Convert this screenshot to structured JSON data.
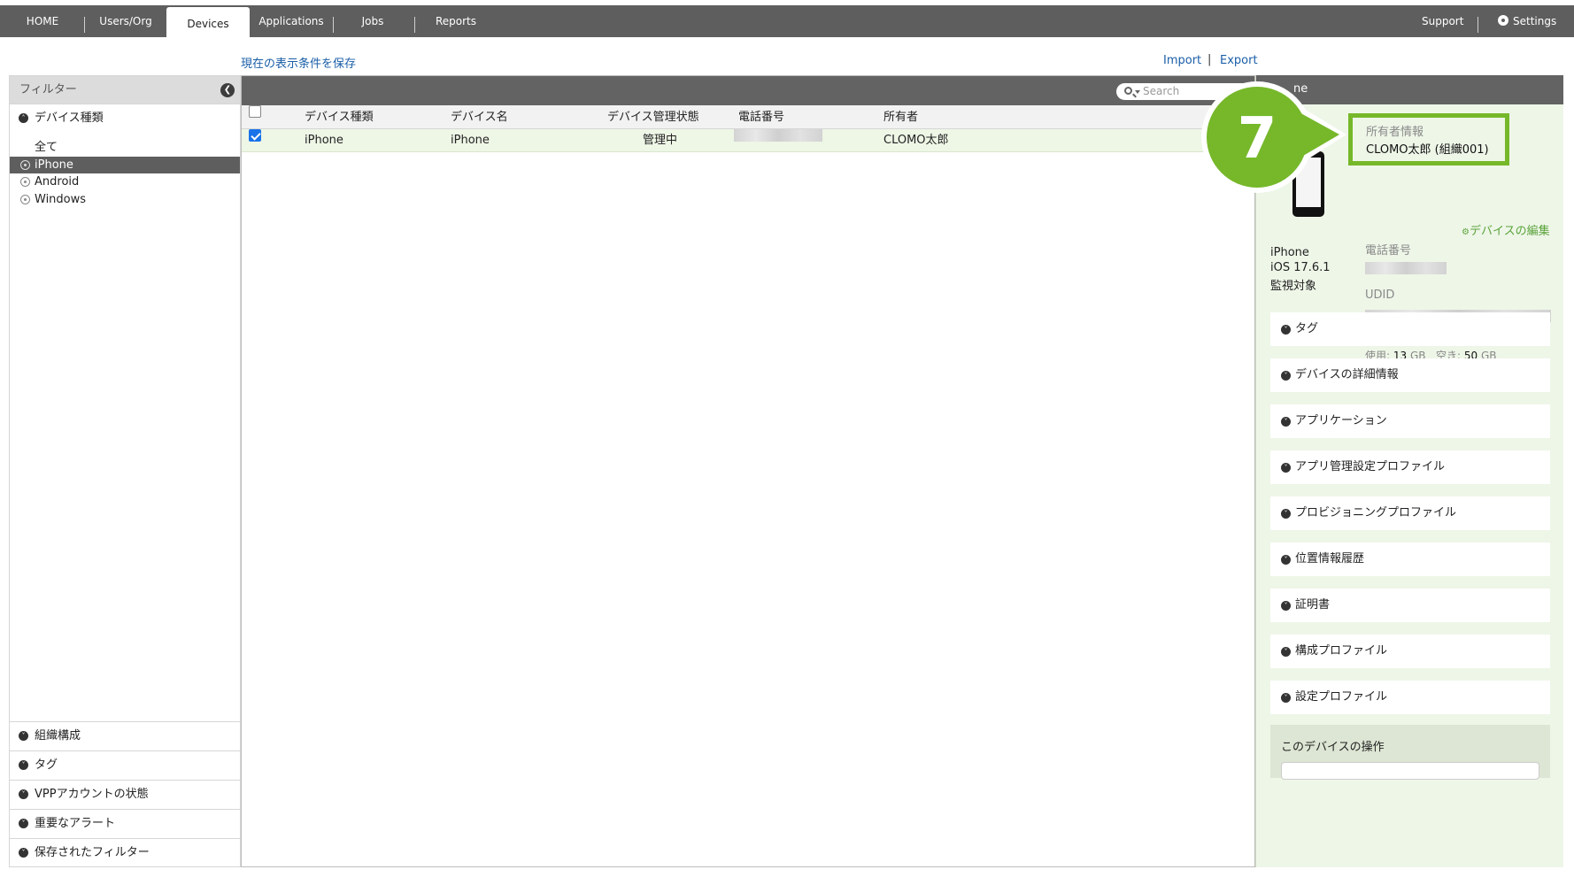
{
  "nav": {
    "tabs": [
      "HOME",
      "Users/Org",
      "Devices",
      "Applications",
      "Jobs",
      "Reports"
    ],
    "active_tab": "Devices",
    "support": "Support",
    "settings": "Settings"
  },
  "toolbar": {
    "save_view": "現在の表示条件を保存",
    "import": "Import",
    "separator": "|",
    "export": "Export"
  },
  "filter": {
    "title": "フィルター",
    "device_type_section": "デバイス種類",
    "items": [
      "全て",
      "iPhone",
      "Android",
      "Windows"
    ],
    "selected": "iPhone",
    "bottom_sections": [
      "組織構成",
      "タグ",
      "VPPアカウントの状態",
      "重要なアラート",
      "保存されたフィルター"
    ]
  },
  "table": {
    "search_placeholder": "Search",
    "headers": [
      "デバイス種類",
      "デバイス名",
      "デバイス管理状態",
      "電話番号",
      "所有者"
    ],
    "rows": [
      {
        "type": "iPhone",
        "name": "iPhone",
        "status": "管理中",
        "owner": "CLOMO太郎",
        "checked": true
      }
    ]
  },
  "detail": {
    "title_fragment": "ne",
    "owner_label": "所有者情報",
    "owner_value": "CLOMO太郎 (組織001)",
    "edit_link": "デバイスの編集",
    "device_model": "iPhone",
    "os_version": "iOS 17.6.1",
    "supervised": "監視対象",
    "phone_label": "電話番号",
    "udid_label": "UDID",
    "storage": {
      "used_label": "使用:",
      "used_value": "13",
      "free_label": "空き:",
      "free_value": "50",
      "unit": "GB",
      "used_fraction": 0.2
    },
    "accordions": [
      "タグ",
      "デバイスの詳細情報",
      "アプリケーション",
      "アプリ管理設定プロファイル",
      "プロビジョニングプロファイル",
      "位置情報履歴",
      "証明書",
      "構成プロファイル",
      "設定プロファイル"
    ],
    "operations_title": "このデバイスの操作"
  },
  "callout": {
    "step_number": "7",
    "color": "#76b82a"
  }
}
